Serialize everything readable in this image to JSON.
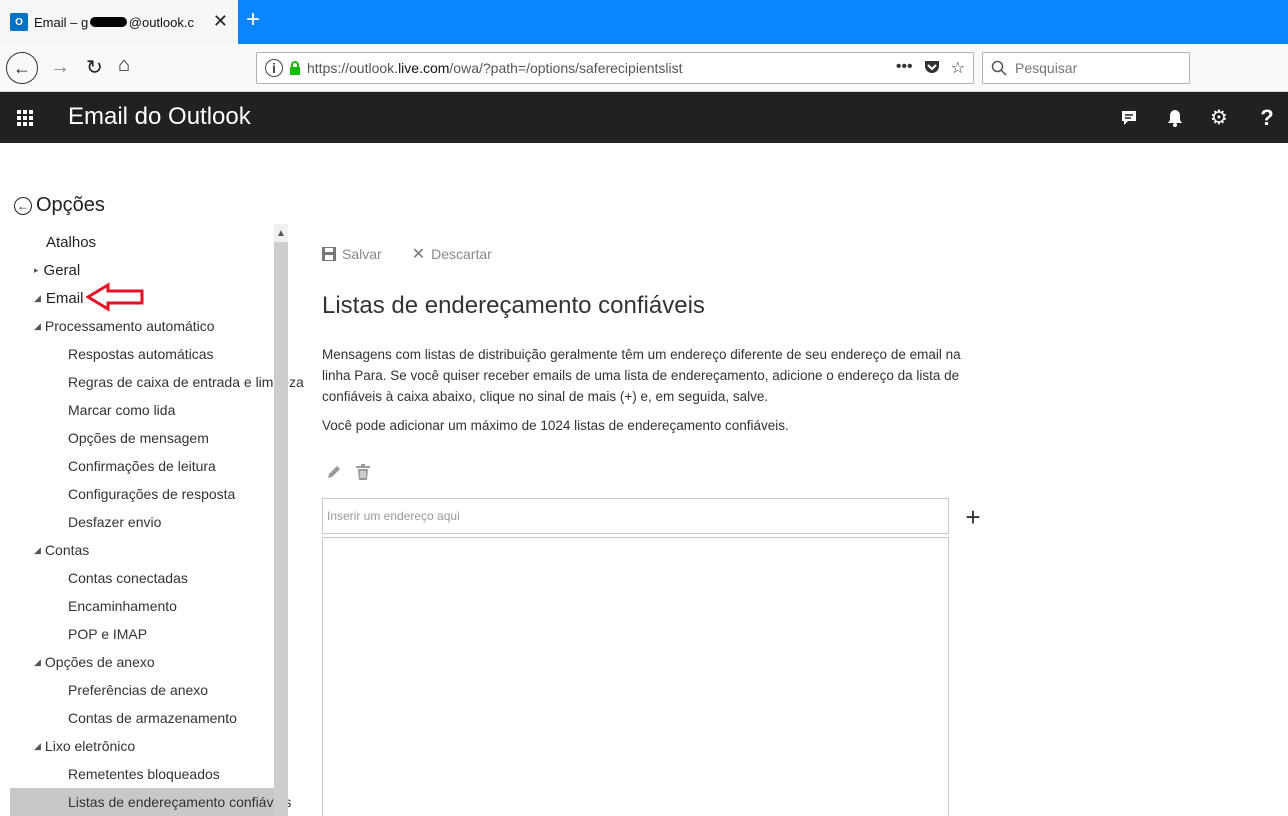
{
  "browser": {
    "tab": {
      "favicon": "O",
      "title_prefix": "Email – g",
      "title_suffix": "@outlook.c",
      "close": "✕"
    },
    "new_tab": "+",
    "url": {
      "prefix": "https://outlook.",
      "host": "live.com",
      "path": "/owa/?path=/options/saferecipientslist"
    },
    "url_more": "•••",
    "search_placeholder": "Pesquisar"
  },
  "header": {
    "title": "Email do Outlook",
    "icons": [
      "chat-icon",
      "bell-icon",
      "gear-icon",
      "help-icon"
    ],
    "help_label": "?"
  },
  "options": {
    "back_label": "Opções"
  },
  "sidebar": {
    "items": [
      {
        "label": "Atalhos",
        "level": 0
      },
      {
        "label": "Geral",
        "level": 0,
        "arrow": "▸"
      },
      {
        "label": "Email",
        "level": 0,
        "arrow": "◢"
      },
      {
        "label": "Processamento automático",
        "level": 1,
        "arrow": "◢"
      },
      {
        "label": "Respostas automáticas",
        "level": 2
      },
      {
        "label": "Regras de caixa de entrada e limpeza",
        "level": 2
      },
      {
        "label": "Marcar como lida",
        "level": 2
      },
      {
        "label": "Opções de mensagem",
        "level": 2
      },
      {
        "label": "Confirmações de leitura",
        "level": 2
      },
      {
        "label": "Configurações de resposta",
        "level": 2
      },
      {
        "label": "Desfazer envio",
        "level": 2
      },
      {
        "label": "Contas",
        "level": 1,
        "arrow": "◢"
      },
      {
        "label": "Contas conectadas",
        "level": 2
      },
      {
        "label": "Encaminhamento",
        "level": 2
      },
      {
        "label": "POP e IMAP",
        "level": 2
      },
      {
        "label": "Opções de anexo",
        "level": 1,
        "arrow": "◢"
      },
      {
        "label": "Preferências de anexo",
        "level": 2
      },
      {
        "label": "Contas de armazenamento",
        "level": 2
      },
      {
        "label": "Lixo eletrônico",
        "level": 1,
        "arrow": "◢"
      },
      {
        "label": "Remetentes bloqueados",
        "level": 2
      },
      {
        "label": "Listas de endereçamento confiáveis",
        "level": 2,
        "selected": true
      }
    ]
  },
  "toolbar": {
    "save_label": "Salvar",
    "discard_label": "Descartar"
  },
  "main": {
    "title": "Listas de endereçamento confiáveis",
    "description": "Mensagens com listas de distribuição geralmente têm um endereço diferente de seu endereço de email na linha Para. Se você quiser receber emails de uma lista de endereçamento, adicione o endereço da lista de confiáveis à caixa abaixo, clique no sinal de mais (+) e, em seguida, salve.",
    "limit_note": "Você pode adicionar um máximo de 1024 listas de endereçamento confiáveis.",
    "input_placeholder": "Inserir um endereço aqui",
    "add_label": "+"
  },
  "colors": {
    "tab_strip": "#0a84ff",
    "header": "#212121",
    "selected_item": "#c8c8c8",
    "annotation_arrow": "#e81123"
  }
}
